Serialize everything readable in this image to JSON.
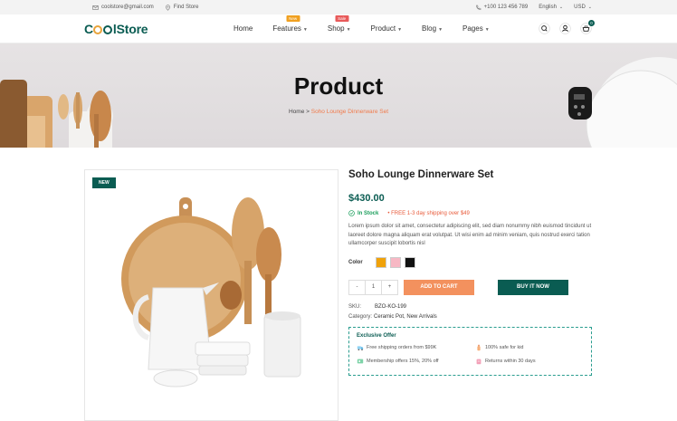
{
  "topbar": {
    "email": "coolstore@gmail.com",
    "find_store": "Find Store",
    "phone": "+100 123 456 789",
    "language": "English",
    "currency": "USD"
  },
  "header": {
    "logo_a": "C",
    "logo_b": "lStore",
    "nav": [
      {
        "label": "Home"
      },
      {
        "label": "Features",
        "badge": "New"
      },
      {
        "label": "Shop",
        "badge": "Sale"
      },
      {
        "label": "Product"
      },
      {
        "label": "Blog"
      },
      {
        "label": "Pages"
      }
    ],
    "cart_count": "0"
  },
  "hero": {
    "title": "Product",
    "breadcrumb_home": "Home",
    "breadcrumb_sep": ">",
    "breadcrumb_current": "Soho Lounge Dinnerware Set"
  },
  "product": {
    "tag": "NEW",
    "title": "Soho Lounge Dinnerware Set",
    "price": "$430.00",
    "stock": "In Stock",
    "shipping": "FREE 1-3 day shipping over $49",
    "description": "Lorem ipsum dolor sit amet, consectetur adipiscing elit, sed diam nonummy nibh euismod tincidunt ut laoreet dolore magna aliquam erat volutpat. Ut wisi enim ad minim veniam, quis nostrud exerci tation ullamcorper suscipit lobortis nisl",
    "color_label": "Color",
    "colors": [
      "#f0a20a",
      "#f7b8c4",
      "#111111"
    ],
    "qty_minus": "-",
    "qty_value": "1",
    "qty_plus": "+",
    "add_to_cart": "ADD TO CART",
    "buy_now": "BUY IT NOW",
    "sku_label": "SKU:",
    "sku_value": "BZO-KO-199",
    "category_label": "Category:",
    "category_value": "Ceramic Pot,  New Arrivals"
  },
  "offer": {
    "title": "Exclusive Offer",
    "items": [
      "Free shipping orders from $99K",
      "100% safe for kid",
      "Membership offers 15%, 20% off",
      "Returns within 30 days"
    ]
  }
}
